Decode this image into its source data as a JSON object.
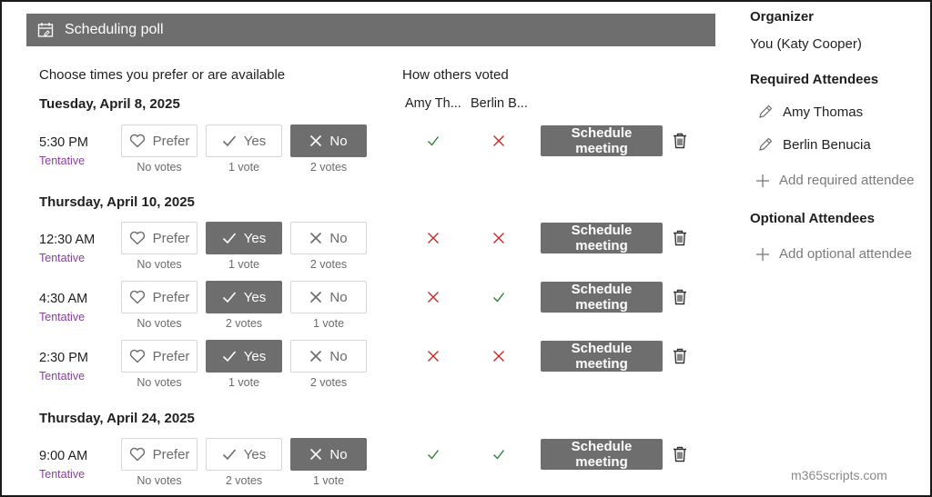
{
  "header": {
    "title": "Scheduling poll"
  },
  "columns": {
    "choose": "Choose times you prefer or are available",
    "others": "How others voted"
  },
  "voters": [
    "Amy Th...",
    "Berlin B..."
  ],
  "labels": {
    "prefer": "Prefer",
    "yes": "Yes",
    "no": "No",
    "schedule": "Schedule meeting",
    "tentative": "Tentative"
  },
  "groups": [
    {
      "date": "Tuesday, April 8, 2025",
      "slots": [
        {
          "time": "5:30 PM",
          "selected": "no",
          "counts": [
            "No votes",
            "1 vote",
            "2 votes"
          ],
          "votes": [
            "yes",
            "no"
          ]
        }
      ]
    },
    {
      "date": "Thursday, April 10, 2025",
      "slots": [
        {
          "time": "12:30 AM",
          "selected": "yes",
          "counts": [
            "No votes",
            "1 vote",
            "2 votes"
          ],
          "votes": [
            "no",
            "no"
          ]
        },
        {
          "time": "4:30 AM",
          "selected": "yes",
          "counts": [
            "No votes",
            "2 votes",
            "1 vote"
          ],
          "votes": [
            "no",
            "yes"
          ]
        },
        {
          "time": "2:30 PM",
          "selected": "yes",
          "counts": [
            "No votes",
            "1 vote",
            "2 votes"
          ],
          "votes": [
            "no",
            "no"
          ]
        }
      ]
    },
    {
      "date": "Thursday, April 24, 2025",
      "slots": [
        {
          "time": "9:00 AM",
          "selected": "no",
          "counts": [
            "No votes",
            "2 votes",
            "1 vote"
          ],
          "votes": [
            "yes",
            "yes"
          ]
        }
      ]
    }
  ],
  "sidebar": {
    "organizer_heading": "Organizer",
    "organizer": "You (Katy Cooper)",
    "required_heading": "Required Attendees",
    "required": [
      "Amy Thomas",
      "Berlin Benucia"
    ],
    "add_required": "Add required attendee",
    "optional_heading": "Optional Attendees",
    "add_optional": "Add optional attendee"
  },
  "watermark": "m365scripts.com",
  "colors": {
    "header_bg": "#6e6e6e",
    "check": "#2e7d32",
    "cross": "#c62828",
    "tentative": "#8a3fa0"
  }
}
